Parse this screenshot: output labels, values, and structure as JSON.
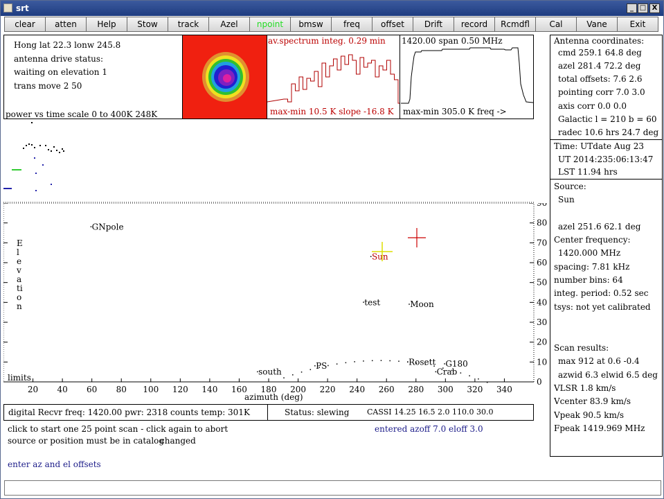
{
  "window": {
    "title": "srt",
    "minimize": "_",
    "maximize": "□",
    "close": "X"
  },
  "toolbar": [
    "clear",
    "atten",
    "Help",
    "Stow",
    "track",
    "Azel",
    "npoint",
    "bmsw",
    "freq",
    "offset",
    "Drift",
    "record",
    "Rcmdfl",
    "Cal",
    "Vane",
    "Exit"
  ],
  "toolbar_active": "npoint",
  "colors": {
    "active": "#22dd22",
    "spectrum": "#b00000",
    "sun_marker": "#dddd00",
    "cross": "#cc0000",
    "blue_text": "#1a1a88"
  },
  "station": {
    "line1": "Hong lat 22.3 lonw 245.8",
    "line2": "antenna drive status:",
    "line3": "waiting on elevation 1",
    "line4": "trans   move 2 50"
  },
  "spectrum1": {
    "title": "av.spectrum integ. 0.29 min",
    "footer": "max-min  10.5 K slope -16.8 K"
  },
  "spectrum2": {
    "title": "1420.00 span   0.50 MHz",
    "footer": "max-min 305.0 K    freq ->"
  },
  "power": {
    "label": "power vs time scale     0 to  400K  248K"
  },
  "antenna": {
    "header": "Antenna coordinates:",
    "cmd": "cmd 259.1  64.8 deg",
    "azel": "azel  281.4  72.2 deg",
    "offsets": "total offsets:    7.6    2.6",
    "pointing": "pointing corr  7.0  3.0",
    "axis": "axis corr   0.0   0.0",
    "galactic": "Galactic l = 210 b = 60",
    "radec": "radec  10.6 hrs  24.7 deg"
  },
  "time": {
    "line1": "Time:      UTdate Aug 23",
    "line2": "UT 2014:235:06:13:47",
    "line3": "LST 11.94 hrs"
  },
  "source": {
    "label": "Source:",
    "name": "Sun",
    "azel": "azel  251.6   62.1 deg",
    "cf_label": "Center frequency:",
    "cf": "1420.000 MHz",
    "spacing": "spacing:     7.81 kHz",
    "bins": "number bins: 64",
    "integ": "integ. period: 0.52 sec",
    "tsys": "tsys: not yet calibrated"
  },
  "scan": {
    "label": "Scan results:",
    "max": "max   912 at    0.6   -0.4",
    "wid": "azwid   6.3 elwid  6.5 deg",
    "vlsr": "VLSR        1.8 km/s",
    "vcenter": "Vcenter    83.9 km/s",
    "vpeak": "Vpeak       90.5 km/s",
    "fpeak": "Fpeak   1419.969 MHz"
  },
  "skymap": {
    "ylabel": "Elevation",
    "xlabel": "azimuth (deg)",
    "limits": "limits",
    "xticks": [
      "20",
      "40",
      "60",
      "80",
      "100",
      "120",
      "140",
      "160",
      "180",
      "200",
      "220",
      "240",
      "260",
      "280",
      "300",
      "320",
      "340"
    ],
    "yticks": [
      "0",
      "10",
      "20",
      "30",
      "40",
      "50",
      "60",
      "70",
      "80",
      "90"
    ],
    "sources": [
      {
        "name": "GNpole",
        "az": 60,
        "el": 78
      },
      {
        "name": "Sun",
        "az": 250,
        "el": 63
      },
      {
        "name": "test",
        "az": 245,
        "el": 40
      },
      {
        "name": "Moon",
        "az": 276,
        "el": 39
      },
      {
        "name": "PS",
        "az": 212,
        "el": 8
      },
      {
        "name": "Rosett",
        "az": 275,
        "el": 10
      },
      {
        "name": "G180",
        "az": 300,
        "el": 9
      },
      {
        "name": "Crab",
        "az": 294,
        "el": 5
      },
      {
        "name": "south",
        "az": 173,
        "el": 5
      }
    ]
  },
  "status": {
    "recvr": "digital Recvr freq: 1420.00  pwr: 2318  counts temp:   301K",
    "status": "Status: slewing",
    "cassi": "CASSI 14.25 16.5 2.0 110.0 30.0"
  },
  "messages": {
    "m1": "click to start one 25 point scan - click again to abort",
    "m2": "source or position must be in catalog",
    "m3": "changed",
    "entered": "entered azoff   7.0  eloff   3.0",
    "prompt": "enter az and el offsets"
  },
  "input": {
    "value": ""
  }
}
